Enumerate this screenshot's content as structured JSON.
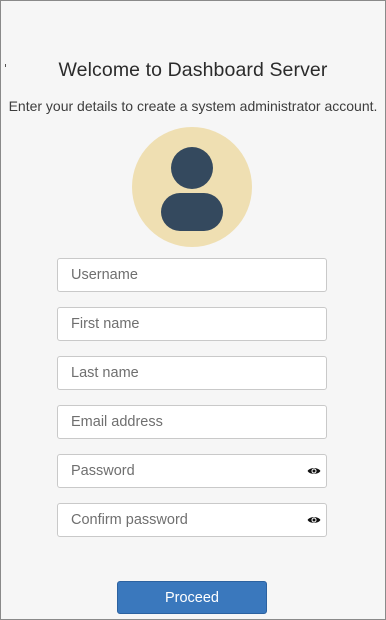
{
  "header": {
    "title": "Welcome to Dashboard Server",
    "subtitle": "Enter your details to create a system administrator account."
  },
  "avatar": {
    "icon": "user-icon",
    "background": "#efdfb2",
    "figure_color": "#34495e"
  },
  "form": {
    "username": {
      "placeholder": "Username",
      "value": ""
    },
    "first_name": {
      "placeholder": "First name",
      "value": ""
    },
    "last_name": {
      "placeholder": "Last name",
      "value": ""
    },
    "email": {
      "placeholder": "Email address",
      "value": ""
    },
    "password": {
      "placeholder": "Password",
      "value": "",
      "icon": "eye-icon"
    },
    "confirm_password": {
      "placeholder": "Confirm password",
      "value": "",
      "icon": "eye-icon"
    }
  },
  "actions": {
    "proceed_label": "Proceed",
    "accent": "#3a78bd"
  }
}
